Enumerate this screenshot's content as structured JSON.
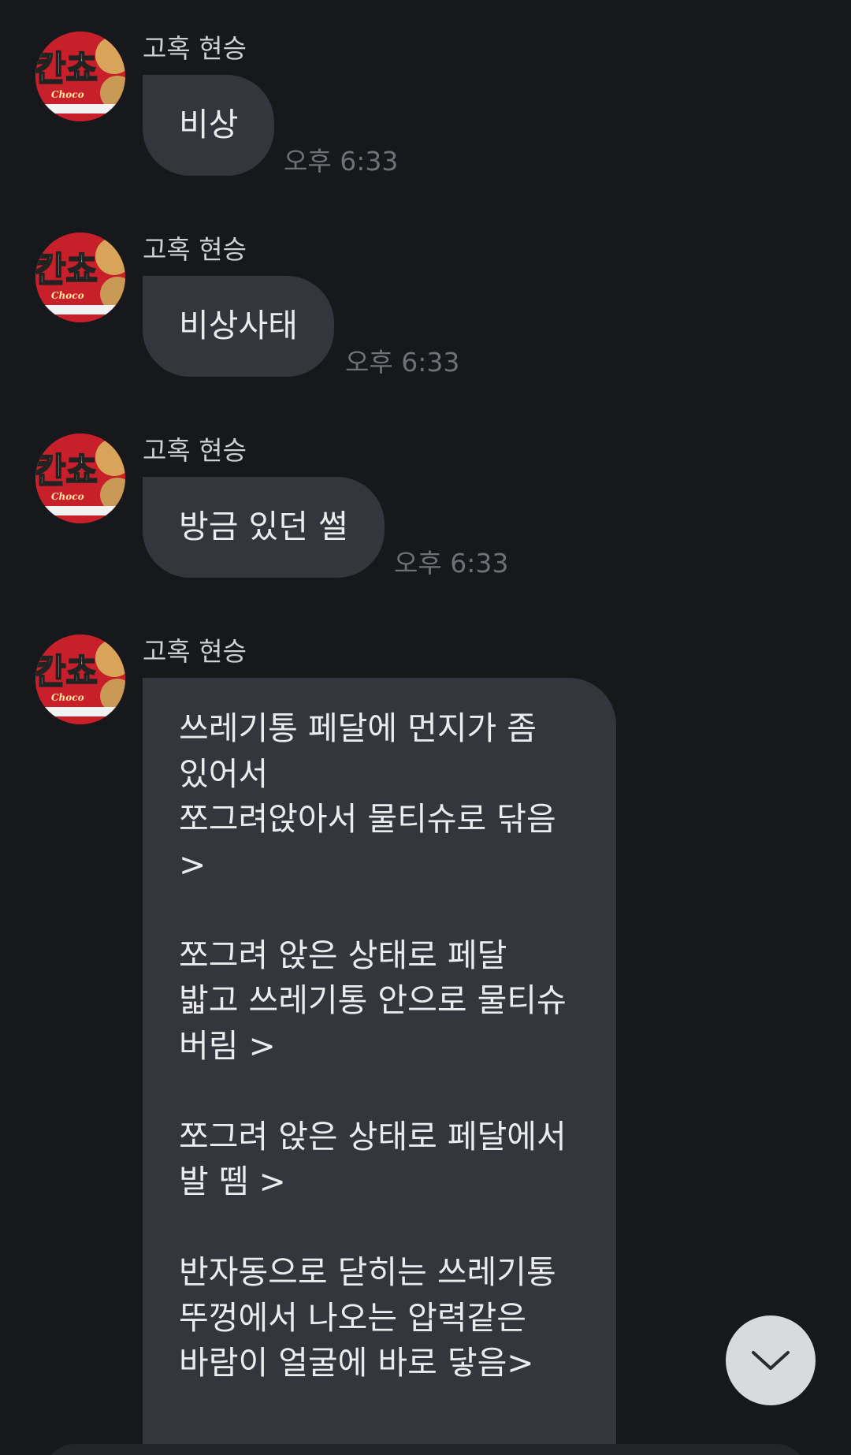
{
  "messages": [
    {
      "sender": "고혹 현승",
      "text": "비상",
      "time": "오후 6:33"
    },
    {
      "sender": "고혹 현승",
      "text": "비상사태",
      "time": "오후 6:33"
    },
    {
      "sender": "고혹 현승",
      "text": "방금 있던 썰",
      "time": "오후 6:33"
    }
  ],
  "long_message": {
    "sender": "고혹 현승",
    "paragraphs": [
      [
        "쓰레기통 페달에 먼지가 좀",
        "있어서",
        "쪼그려앉아서 물티슈로 닦음",
        ">"
      ],
      [
        "쪼그려 앉은 상태로 페달",
        "밟고 쓰레기통 안으로 물티슈",
        "버림 >"
      ],
      [
        "쪼그려 앉은 상태로 페달에서",
        "발 뗌 >"
      ],
      [
        "반자동으로 닫히는 쓰레기통",
        "뚜껑에서 나오는 압력같은",
        "바람이 얼굴에 바로 닿음>"
      ]
    ]
  },
  "avatar_text": {
    "main": "칸쵸",
    "sub": "Choco"
  },
  "icons": {
    "scroll_down": "chevron-down-icon",
    "avatar": "avatar-image"
  },
  "colors": {
    "background": "#17181c",
    "bubble": "#34363d",
    "time": "#6f7178",
    "scroll_button": "#d9dadd"
  }
}
